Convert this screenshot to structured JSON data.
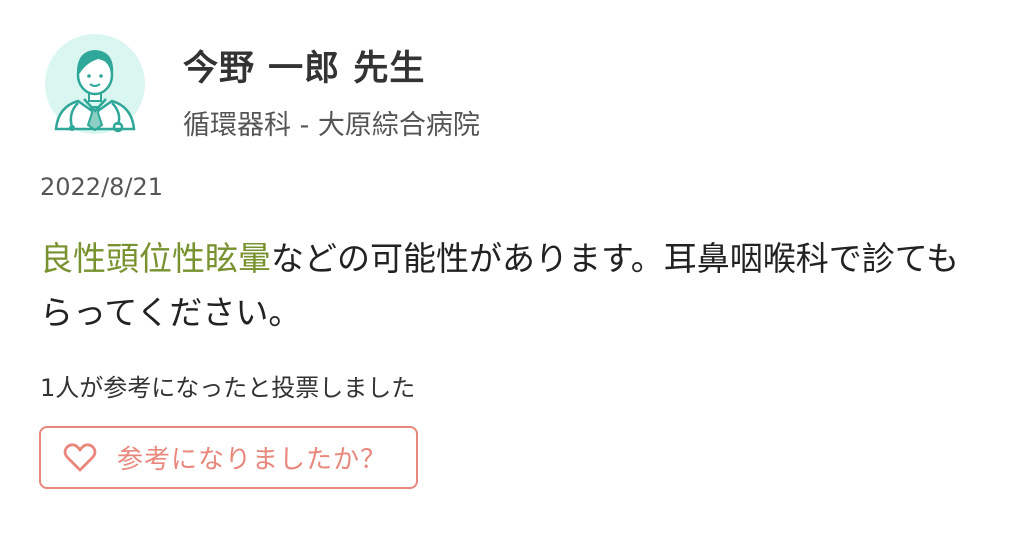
{
  "doctor": {
    "name": "今野 一郎 先生",
    "department_hospital": "循環器科 - 大原綜合病院",
    "avatar_icon": "doctor-avatar-icon"
  },
  "answer": {
    "date": "2022/8/21",
    "highlighted_text": "良性頭位性眩暈",
    "line1_rest": "などの可能性があります。耳鼻咽喉科で診ても",
    "line2": "らってください。"
  },
  "helpful": {
    "count_text": "1人が参考になったと投票しました",
    "button_label": "参考になりましたか？",
    "button_icon": "heart-icon"
  },
  "colors": {
    "accent": "#e8877c",
    "highlight_bg": "#fbf59a",
    "highlight_text": "#77922f",
    "avatar_bg": "#d9f6f0",
    "avatar_line": "#2fa89a"
  }
}
